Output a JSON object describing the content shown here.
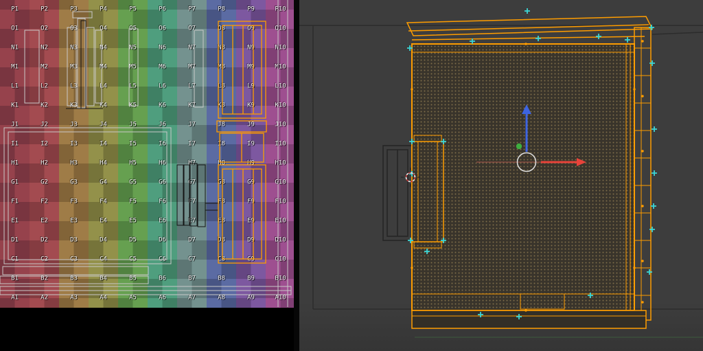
{
  "uv_editor": {
    "grid": {
      "rows": [
        "P",
        "O",
        "N",
        "M",
        "L",
        "K",
        "J",
        "I",
        "H",
        "G",
        "F",
        "E",
        "D",
        "C",
        "B",
        "A"
      ],
      "columns": [
        "1",
        "2",
        "3",
        "4",
        "5",
        "6",
        "7",
        "8",
        "9",
        "10"
      ],
      "column_colors": [
        {
          "light": "#96424c",
          "dark": "#793540"
        },
        {
          "light": "#a34b50",
          "dark": "#853c41"
        },
        {
          "light": "#9f7c47",
          "dark": "#826438"
        },
        {
          "light": "#93914a",
          "dark": "#76743a"
        },
        {
          "light": "#66a050",
          "dark": "#518240"
        },
        {
          "light": "#4f9e7e",
          "dark": "#3f8064"
        },
        {
          "light": "#74928f",
          "dark": "#5d7674"
        },
        {
          "light": "#5b6ba3",
          "dark": "#485584"
        },
        {
          "light": "#7d58a0",
          "dark": "#654682"
        },
        {
          "light": "#9e4f90",
          "dark": "#803f74"
        }
      ],
      "label_color": "#f2f2f2"
    },
    "overlay_colors": {
      "unselected_island": "#c9c9c9",
      "dark_island": "#141414",
      "selected_island": "#ff9d00"
    }
  },
  "viewport_3d": {
    "background": "#3c3c3c",
    "selection_color": "#ff9d00",
    "seam_color": "#3bd6d6",
    "beam_fill": "#332f27",
    "texture": {
      "base": "#39342b",
      "dot": "#7f6e49"
    },
    "ground_axis_color": "#3e5c3e",
    "gizmo": {
      "axis_x_color": "#e8433a",
      "axis_y_color": "#3fae3f",
      "axis_z_color": "#3d64e0",
      "axis_line_color": "#c26055",
      "ring_color": "#e0e0e0"
    },
    "cursor_3d": {
      "red": "#cc3b3b",
      "white": "#ececec"
    }
  }
}
